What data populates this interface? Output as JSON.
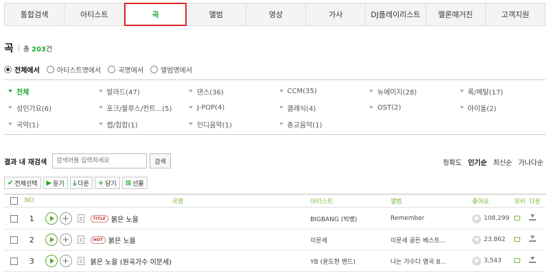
{
  "tabs": [
    "통합검색",
    "아티스트",
    "곡",
    "앨범",
    "영상",
    "가사",
    "DJ플레이리스트",
    "멜론매거진",
    "고객지원"
  ],
  "active_tab": 2,
  "section": {
    "title": "곡",
    "total_label": "총",
    "count": "203",
    "count_unit": "건"
  },
  "radios": [
    {
      "label": "전체에서",
      "selected": true
    },
    {
      "label": "아티스트명에서",
      "selected": false
    },
    {
      "label": "곡명에서",
      "selected": false
    },
    {
      "label": "앨범명에서",
      "selected": false
    }
  ],
  "genres": [
    [
      "전체",
      "발라드(47)",
      "댄스(36)",
      "CCM(35)",
      "뉴에이지(28)",
      "록/메탈(17)"
    ],
    [
      "성인가요(6)",
      "포크/블루스/컨트...(5)",
      "J-POP(4)",
      "클래식(4)",
      "OST(2)",
      "아이돌(2)"
    ],
    [
      "국악(1)",
      "랩/힙합(1)",
      "인디음악(1)",
      "종교음악(1)",
      "",
      ""
    ]
  ],
  "research": {
    "label": "결과 내 재검색",
    "placeholder": "검색어를 입력하세요",
    "button": "검색"
  },
  "sort": [
    "정확도",
    "인기순",
    "최신순",
    "가나다순"
  ],
  "sort_active": 1,
  "toolbar": {
    "select_all": "전체선택",
    "listen": "듣기",
    "download": "다운",
    "add": "담기",
    "gift": "선물"
  },
  "table": {
    "headers": {
      "no": "NO",
      "song": "곡명",
      "artist": "아티스트",
      "album": "앨범",
      "like": "좋아요",
      "mv": "뮤비",
      "down": "다운"
    },
    "rows": [
      {
        "no": "1",
        "badge": "TITLE",
        "title": "붉은 노을",
        "artist": "BIGBANG (빅뱅)",
        "album": "Remember",
        "likes": "108,299"
      },
      {
        "no": "2",
        "badge": "HOT",
        "title": "붉은 노을",
        "artist": "이문세",
        "album": "이문세 골든 베스트...",
        "likes": "23,862"
      },
      {
        "no": "3",
        "badge": "",
        "title": "붉은 노을 (원곡가수 이문세)",
        "artist": "YB (윤도현 밴드)",
        "album": "나는 가수다 명곡 B...",
        "likes": "3,543"
      }
    ]
  },
  "colors": {
    "accent": "#1aaa2a",
    "tab_highlight": "#e0242b"
  }
}
